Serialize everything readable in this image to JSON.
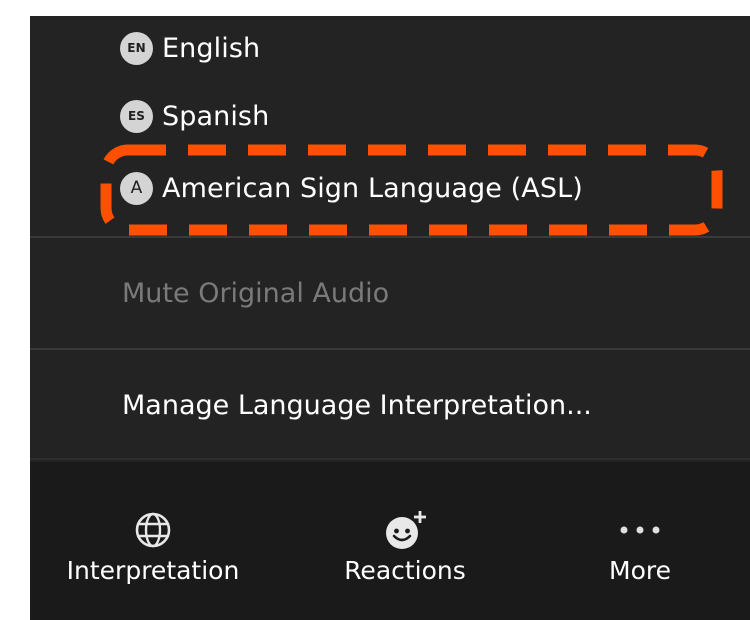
{
  "languages": [
    {
      "badge": "EN",
      "label": "English"
    },
    {
      "badge": "ES",
      "label": "Spanish"
    },
    {
      "badge": "A",
      "label": "American Sign Language (ASL)"
    }
  ],
  "menu": {
    "mute_original_audio": "Mute Original Audio",
    "manage_interpretation": "Manage Language Interpretation..."
  },
  "toolbar": {
    "interpretation_label": "Interpretation",
    "interpretation_icon": "globe-icon",
    "reactions_label": "Reactions",
    "reactions_icon": "smiley-plus-icon",
    "more_label": "More",
    "more_icon": "ellipsis-icon"
  },
  "colors": {
    "menu_background": "#232323",
    "toolbar_background": "#1a1a1a",
    "highlight": "#ff4f00",
    "disabled_text": "#7a7a7a"
  }
}
